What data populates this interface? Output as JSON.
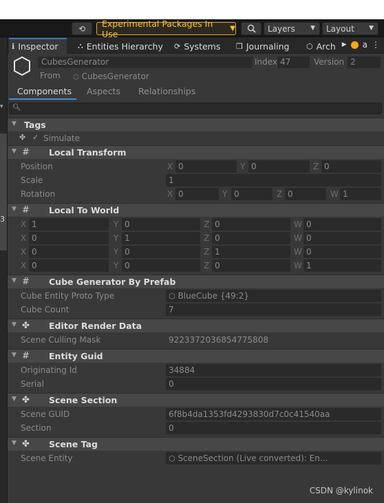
{
  "toolbar": {
    "exp_label": "Experimental Packages In Use",
    "layers_label": "Layers",
    "layout_label": "Layout"
  },
  "tabs": [
    {
      "label": "Inspector",
      "icon": "info-icon"
    },
    {
      "label": "Entities Hierarchy",
      "icon": "hierarchy-icon"
    },
    {
      "label": "Systems",
      "icon": "refresh-icon"
    },
    {
      "label": "Journaling",
      "icon": "journal-icon"
    },
    {
      "label": "Arch",
      "icon": "archetype-icon"
    }
  ],
  "header": {
    "name": "CubesGenerator",
    "index_label": "Index",
    "index_value": "47",
    "version_label": "Version",
    "version_value": "2",
    "from_label": "From",
    "from_value": "CubesGenerator"
  },
  "subtabs": [
    "Components",
    "Aspects",
    "Relationships"
  ],
  "tags": {
    "title": "Tags",
    "simulate": "Simulate"
  },
  "sections": {
    "local_transform": {
      "title": "Local Transform",
      "position": {
        "label": "Position",
        "x": "0",
        "y": "0",
        "z": "0"
      },
      "scale": {
        "label": "Scale",
        "value": "1"
      },
      "rotation": {
        "label": "Rotation",
        "x": "0",
        "y": "0",
        "z": "0",
        "w": "1"
      }
    },
    "local_to_world": {
      "title": "Local To World",
      "rows": [
        [
          "1",
          "0",
          "0",
          "0"
        ],
        [
          "0",
          "1",
          "0",
          "0"
        ],
        [
          "0",
          "0",
          "1",
          "0"
        ],
        [
          "0",
          "0",
          "0",
          "1"
        ]
      ]
    },
    "cube_generator": {
      "title": "Cube Generator By Prefab",
      "proto_label": "Cube Entity Proto Type",
      "proto_value": "BlueCube {49:2}",
      "count_label": "Cube Count",
      "count_value": "7"
    },
    "editor_render": {
      "title": "Editor Render Data",
      "mask_label": "Scene Culling Mask",
      "mask_value": "9223372036854775808"
    },
    "entity_guid": {
      "title": "Entity Guid",
      "orig_label": "Originating Id",
      "orig_value": "34884",
      "serial_label": "Serial",
      "serial_value": "0"
    },
    "scene_section": {
      "title": "Scene Section",
      "guid_label": "Scene GUID",
      "guid_value": "6f8b4da1353fd4293830d7c0c41540aa",
      "section_label": "Section",
      "section_value": "0"
    },
    "scene_tag": {
      "title": "Scene Tag",
      "entity_label": "Scene Entity",
      "entity_value": "SceneSection (Live converted): En..."
    }
  },
  "axes": {
    "x": "X",
    "y": "Y",
    "z": "Z",
    "w": "W"
  },
  "watermark": "CSDN @kylinok"
}
